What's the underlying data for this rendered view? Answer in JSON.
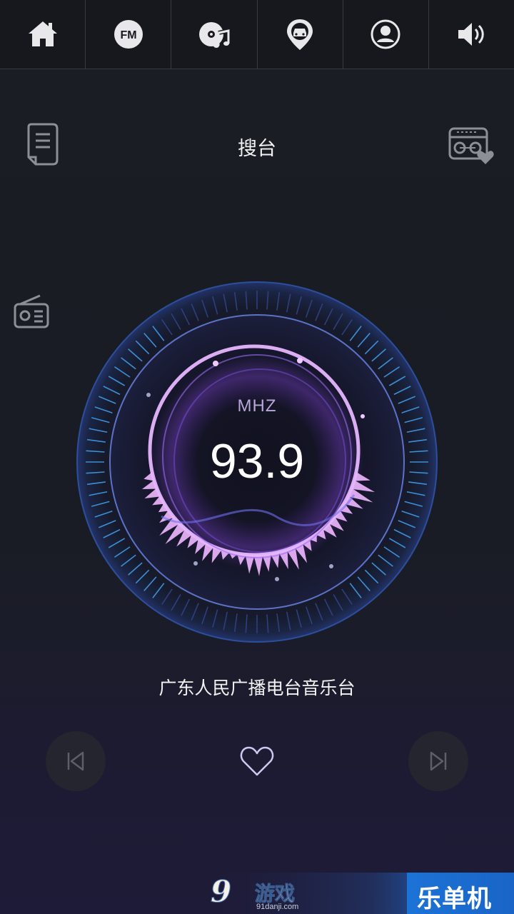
{
  "nav": {
    "items": [
      {
        "icon": "home-icon"
      },
      {
        "icon": "fm-icon",
        "label": "FM"
      },
      {
        "icon": "music-disc-icon"
      },
      {
        "icon": "car-location-icon"
      },
      {
        "icon": "user-icon"
      },
      {
        "icon": "volume-icon"
      }
    ]
  },
  "header": {
    "title": "搜台"
  },
  "tuner": {
    "unit": "MHZ",
    "frequency": "93.9"
  },
  "station": {
    "name": "广东人民广播电台音乐台"
  },
  "controls": {
    "prev_icon": "skip-previous-icon",
    "favorite_icon": "heart-icon",
    "next_icon": "skip-next-icon"
  },
  "watermark": {
    "logo": "9",
    "site_name": "游戏",
    "site_url": "91danji.com",
    "brand": "乐单机"
  },
  "colors": {
    "background": "#1a1c25",
    "accent_purple": "#c78cff",
    "dial_blue": "#3b8fd6",
    "icon_gray": "#8d8f97"
  }
}
